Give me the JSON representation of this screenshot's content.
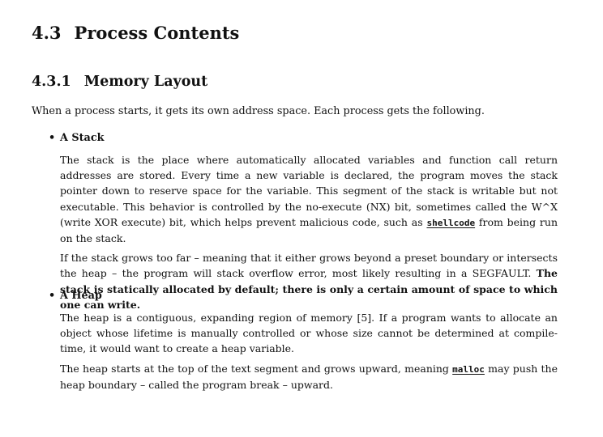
{
  "section": {
    "number": "4.3",
    "title": "Process Contents"
  },
  "subsection": {
    "number": "4.3.1",
    "title": "Memory Layout"
  },
  "intro": "When a process starts, it gets its own address space. Each process gets the following.",
  "stack": {
    "bullet": "•",
    "label": "A Stack",
    "p1_a": "The stack is the place where automatically allocated variables and function call return addresses are stored. Every time a new variable is declared, the program moves the stack pointer down to reserve space for the variable. This segment of the stack is writable but not executable. This behavior is controlled by the no-execute (NX) bit, sometimes called the W^X (write XOR execute) bit, which helps prevent malicious code, such as ",
    "p1_code": "shellcode",
    "p1_b": " from being run on the stack.",
    "p2_a": "If the stack grows too far – meaning that it either grows beyond a preset boundary or intersects the heap – the program will stack overflow error, most likely resulting in a SEGFAULT. ",
    "p2_bold": "The stack is statically allocated by default; there is only a certain amount of space to which one can write."
  },
  "heap": {
    "bullet": "•",
    "label": "A Heap",
    "p1": "The heap is a contiguous, expanding region of memory [5]. If a program wants to allocate an object whose lifetime is manually controlled or whose size cannot be determined at compile-time, it would want to create a heap variable.",
    "p2_a": "The heap starts at the top of the text segment and grows upward, meaning ",
    "p2_code": "malloc",
    "p2_b": " may push the heap boundary – called the program break – upward."
  }
}
